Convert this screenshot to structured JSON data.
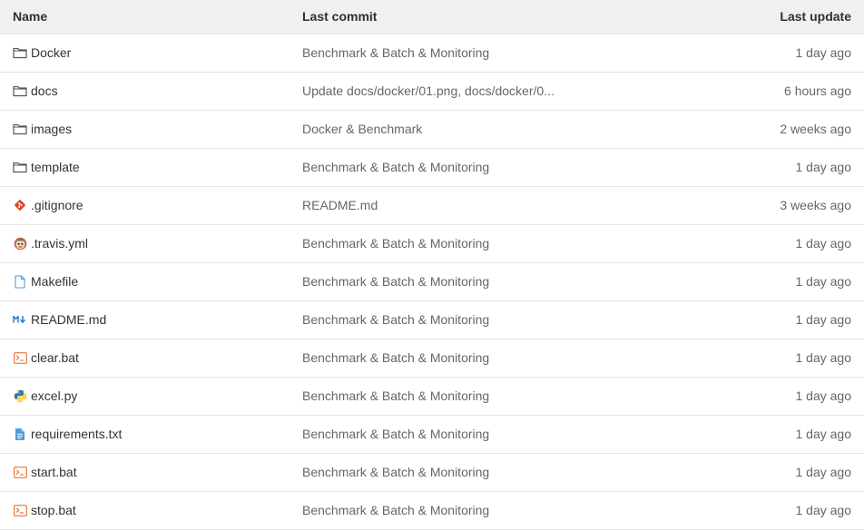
{
  "columns": {
    "name": "Name",
    "last_commit": "Last commit",
    "last_update": "Last update"
  },
  "rows": [
    {
      "name": "Docker",
      "icon": "folder-icon",
      "commit": "Benchmark & Batch & Monitoring",
      "updated": "1 day ago"
    },
    {
      "name": "docs",
      "icon": "folder-icon",
      "commit": "Update docs/docker/01.png, docs/docker/0...",
      "updated": "6 hours ago"
    },
    {
      "name": "images",
      "icon": "folder-icon",
      "commit": "Docker & Benchmark",
      "updated": "2 weeks ago"
    },
    {
      "name": "template",
      "icon": "folder-icon",
      "commit": "Benchmark & Batch & Monitoring",
      "updated": "1 day ago"
    },
    {
      "name": ".gitignore",
      "icon": "git-icon",
      "commit": "README.md",
      "updated": "3 weeks ago"
    },
    {
      "name": ".travis.yml",
      "icon": "travis-icon",
      "commit": "Benchmark & Batch & Monitoring",
      "updated": "1 day ago"
    },
    {
      "name": "Makefile",
      "icon": "file-icon",
      "commit": "Benchmark & Batch & Monitoring",
      "updated": "1 day ago"
    },
    {
      "name": "README.md",
      "icon": "markdown-icon",
      "commit": "Benchmark & Batch & Monitoring",
      "updated": "1 day ago"
    },
    {
      "name": "clear.bat",
      "icon": "terminal-icon",
      "commit": "Benchmark & Batch & Monitoring",
      "updated": "1 day ago"
    },
    {
      "name": "excel.py",
      "icon": "python-icon",
      "commit": "Benchmark & Batch & Monitoring",
      "updated": "1 day ago"
    },
    {
      "name": "requirements.txt",
      "icon": "text-file-icon",
      "commit": "Benchmark & Batch & Monitoring",
      "updated": "1 day ago"
    },
    {
      "name": "start.bat",
      "icon": "terminal-icon",
      "commit": "Benchmark & Batch & Monitoring",
      "updated": "1 day ago"
    },
    {
      "name": "stop.bat",
      "icon": "terminal-icon",
      "commit": "Benchmark & Batch & Monitoring",
      "updated": "1 day ago"
    }
  ],
  "colors": {
    "header_bg": "#f0f0f0",
    "border": "#e5e5e5",
    "git": "#e24329",
    "markdown": "#1f78d1",
    "terminal": "#e8743b",
    "python_blue": "#3572a5",
    "python_yellow": "#ffd43b",
    "text_file": "#4a9ee0"
  }
}
